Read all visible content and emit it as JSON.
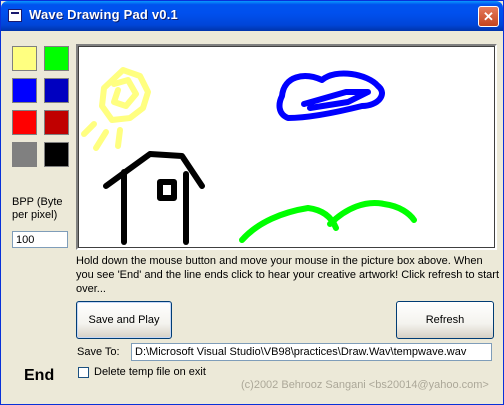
{
  "window": {
    "title": "Wave Drawing Pad v0.1",
    "close_glyph": "✕",
    "icon": "app-window-icon"
  },
  "palette": {
    "swatches": [
      {
        "name": "light-yellow",
        "color": "#ffff80"
      },
      {
        "name": "green",
        "color": "#00ff00"
      },
      {
        "name": "blue",
        "color": "#0000ff"
      },
      {
        "name": "navy-blue",
        "color": "#0000c0"
      },
      {
        "name": "red",
        "color": "#ff0000"
      },
      {
        "name": "dark-red",
        "color": "#c00000"
      },
      {
        "name": "gray",
        "color": "#808080"
      },
      {
        "name": "black",
        "color": "#000000"
      }
    ]
  },
  "bpp": {
    "label": "BPP (Byte per pixel)",
    "value": "100"
  },
  "instructions": "Hold down the mouse button and move your mouse in the picture box above. When you see  'End'  and the line ends click to hear your creative artwork! Click refresh to start over...",
  "buttons": {
    "save_play": "Save and Play",
    "refresh": "Refresh"
  },
  "save_to": {
    "label": "Save To:",
    "path": "D:\\Microsoft Visual Studio\\VB98\\practices\\Draw.Wav\\tempwave.wav"
  },
  "status": {
    "end_label": "End"
  },
  "delete_option": {
    "label": "Delete temp file on exit",
    "checked": false
  },
  "footer": {
    "copyright": "(c)2002 Behrooz Sangani <bs20014@yahoo.com>"
  },
  "drawing": {
    "colors": {
      "sun": "#ffff80",
      "cloud": "#0000ff",
      "house": "#000000",
      "hills": "#00ff00"
    }
  }
}
